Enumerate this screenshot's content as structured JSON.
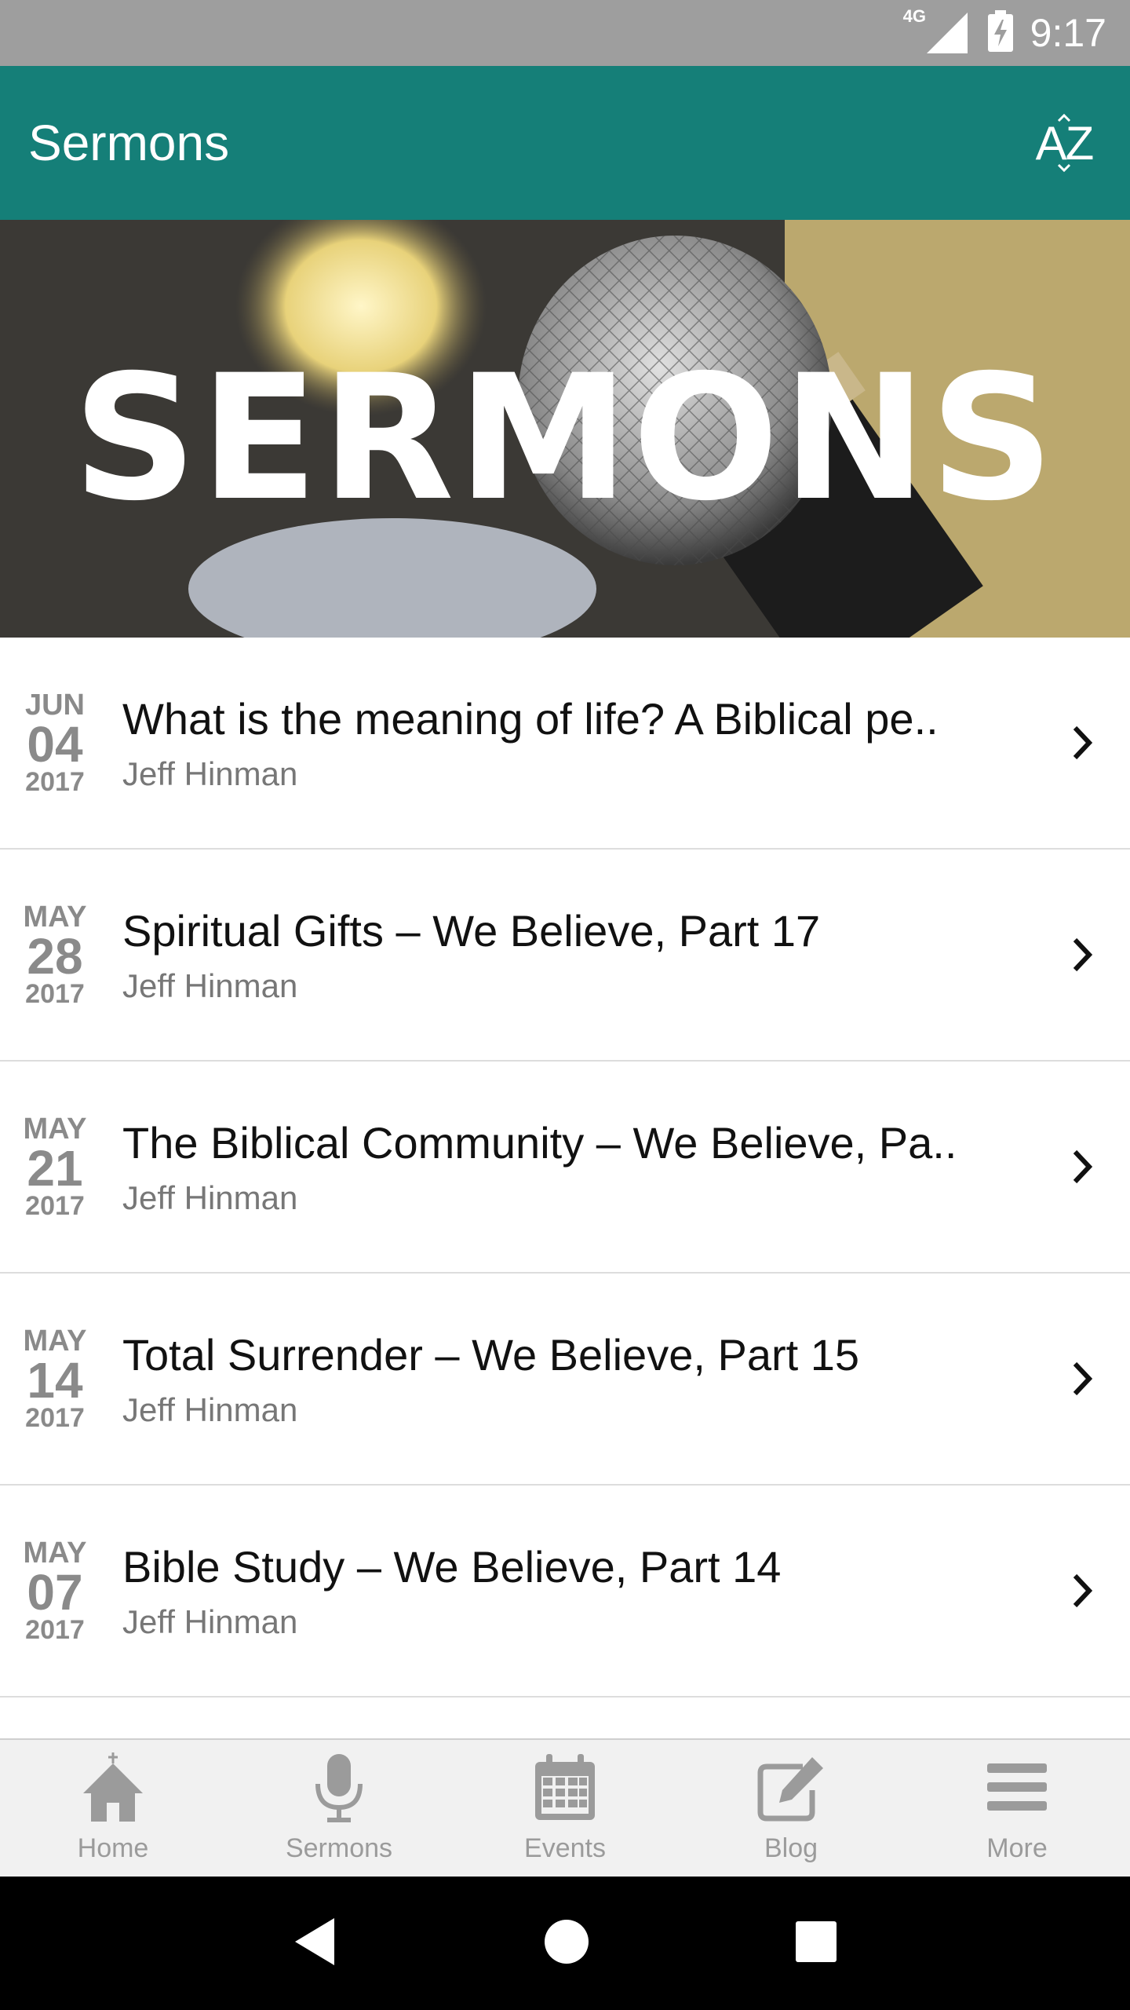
{
  "status_bar": {
    "network": "4G",
    "time": "9:17"
  },
  "app_bar": {
    "title": "Sermons",
    "sort_icon": "az-sort-icon",
    "sort_label": "AZ"
  },
  "banner": {
    "title": "SERMONS"
  },
  "sermons": [
    {
      "month": "JUN",
      "day": "04",
      "year": "2017",
      "title": "What is the meaning of life? A Biblical pe..",
      "speaker": "Jeff Hinman"
    },
    {
      "month": "MAY",
      "day": "28",
      "year": "2017",
      "title": "Spiritual Gifts – We Believe, Part 17",
      "speaker": "Jeff Hinman"
    },
    {
      "month": "MAY",
      "day": "21",
      "year": "2017",
      "title": "The Biblical Community – We Believe, Pa..",
      "speaker": "Jeff Hinman"
    },
    {
      "month": "MAY",
      "day": "14",
      "year": "2017",
      "title": "Total Surrender – We Believe, Part 15",
      "speaker": "Jeff Hinman"
    },
    {
      "month": "MAY",
      "day": "07",
      "year": "2017",
      "title": "Bible Study – We Believe, Part 14",
      "speaker": "Jeff Hinman"
    }
  ],
  "bottom_nav": {
    "items": [
      {
        "label": "Home",
        "icon": "home-icon"
      },
      {
        "label": "Sermons",
        "icon": "microphone-icon"
      },
      {
        "label": "Events",
        "icon": "calendar-icon"
      },
      {
        "label": "Blog",
        "icon": "edit-icon"
      },
      {
        "label": "More",
        "icon": "menu-icon"
      }
    ]
  },
  "colors": {
    "app_bar": "#157f78",
    "status_bar": "#9e9e9e",
    "nav_bg": "#f1f1f1"
  }
}
